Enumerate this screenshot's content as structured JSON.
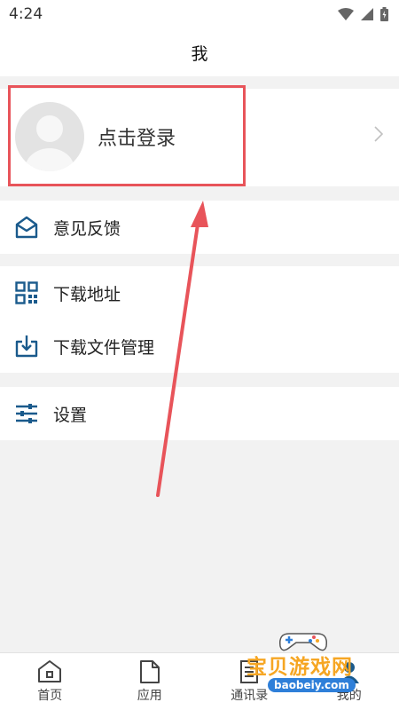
{
  "status_bar": {
    "time": "4:24"
  },
  "header": {
    "title": "我"
  },
  "profile": {
    "login_label": "点击登录"
  },
  "menu": {
    "feedback": "意见反馈",
    "download_address": "下载地址",
    "download_manager": "下载文件管理",
    "settings": "设置"
  },
  "tabs": [
    {
      "label": "首页",
      "icon": "home-icon"
    },
    {
      "label": "应用",
      "icon": "file-icon"
    },
    {
      "label": "通讯录",
      "icon": "contacts-icon"
    },
    {
      "label": "我的",
      "icon": "profile-icon"
    }
  ],
  "watermark": {
    "text": "宝贝游戏网",
    "url": "baobeiy.com"
  },
  "colors": {
    "accent": "#1a5a8c",
    "highlight": "#e8545a",
    "background": "#f2f2f2"
  }
}
